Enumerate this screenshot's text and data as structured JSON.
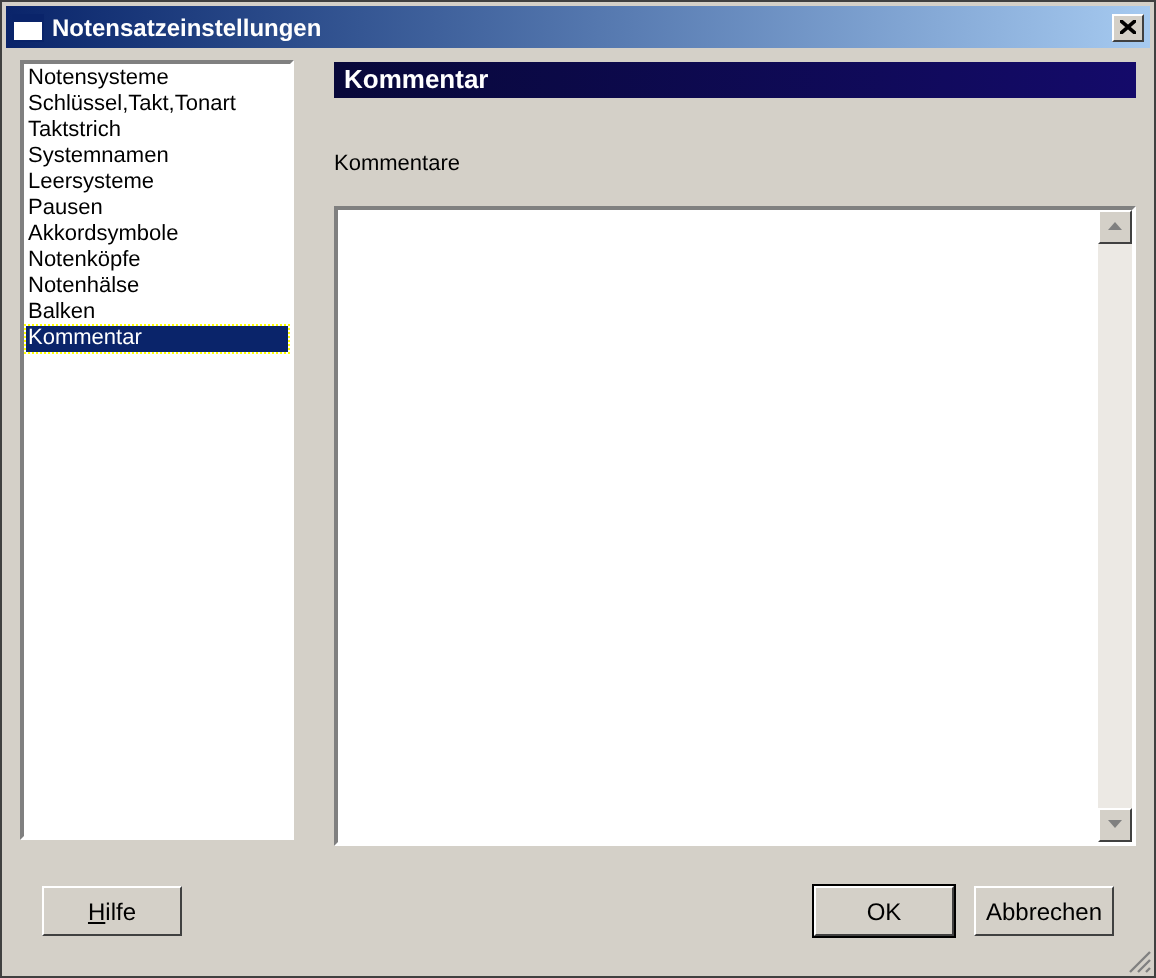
{
  "window": {
    "title": "Notensatzeinstellungen"
  },
  "sidebar": {
    "items": [
      {
        "label": "Notensysteme",
        "selected": false
      },
      {
        "label": "Schlüssel,Takt,Tonart",
        "selected": false
      },
      {
        "label": "Taktstrich",
        "selected": false
      },
      {
        "label": "Systemnamen",
        "selected": false
      },
      {
        "label": "Leersysteme",
        "selected": false
      },
      {
        "label": "Pausen",
        "selected": false
      },
      {
        "label": "Akkordsymbole",
        "selected": false
      },
      {
        "label": "Notenköpfe",
        "selected": false
      },
      {
        "label": "Notenhälse",
        "selected": false
      },
      {
        "label": "Balken",
        "selected": false
      },
      {
        "label": "Kommentar",
        "selected": true
      }
    ]
  },
  "panel": {
    "title": "Kommentar",
    "field_label": "Kommentare"
  },
  "buttons": [
    {
      "label": "Hilfe",
      "underline_first": true,
      "default": false
    },
    {
      "label": "OK",
      "underline_first": false,
      "default": true
    },
    {
      "label": "Abbrechen",
      "underline_first": false,
      "default": false
    }
  ]
}
